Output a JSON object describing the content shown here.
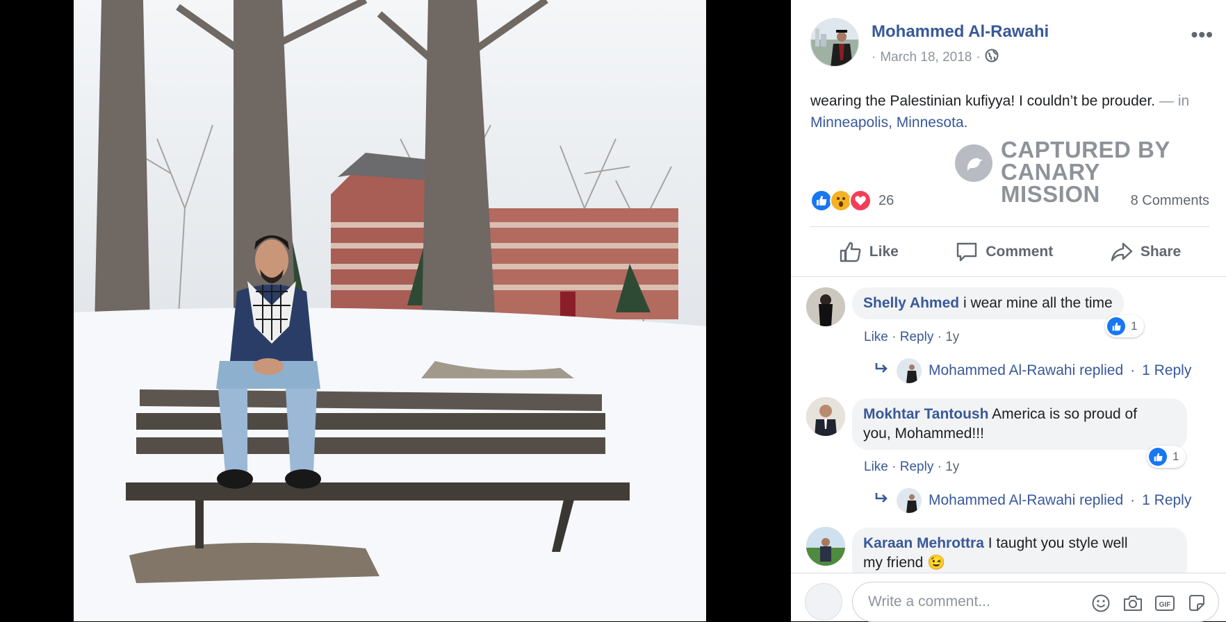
{
  "post": {
    "author": "Mohammed Al-Rawahi",
    "date_prefix": "·",
    "date": "March 18, 2018",
    "date_suffix": "·",
    "privacy_icon": "globe-icon",
    "text": "wearing the Palestinian kufiyya! I couldn’t be prouder.",
    "location_sep": "— in",
    "location": "Minneapolis, Minnesota.",
    "watermark_line1": "CAPTURED BY",
    "watermark_line2": "CANARY MISSION",
    "reaction_count": "26",
    "comments_count": "8 Comments"
  },
  "actions": {
    "like": "Like",
    "comment": "Comment",
    "share": "Share"
  },
  "comments": [
    {
      "name": "Shelly Ahmed",
      "text": "i wear mine all the time",
      "like": "Like",
      "reply": "Reply",
      "time": "1y",
      "reactions": "1",
      "reply_author": "Mohammed Al-Rawahi replied",
      "reply_sep": "·",
      "reply_count": "1 Reply"
    },
    {
      "name": "Mokhtar Tantoush",
      "text_line1": "America is so proud of",
      "text_line2": "you, Mohammed!!!",
      "like": "Like",
      "reply": "Reply",
      "time": "1y",
      "reactions": "1",
      "reply_author": "Mohammed Al-Rawahi replied",
      "reply_sep": "·",
      "reply_count": "1 Reply"
    },
    {
      "name": "Karaan Mehrottra",
      "text_line1": "I taught you style well",
      "text_line2": "my friend 😉"
    }
  ],
  "composer": {
    "placeholder": "Write a comment..."
  },
  "colors": {
    "link": "#385898",
    "like_blue": "#1877f2",
    "love_red": "#f33e58",
    "wow_yellow": "#f7b125"
  }
}
